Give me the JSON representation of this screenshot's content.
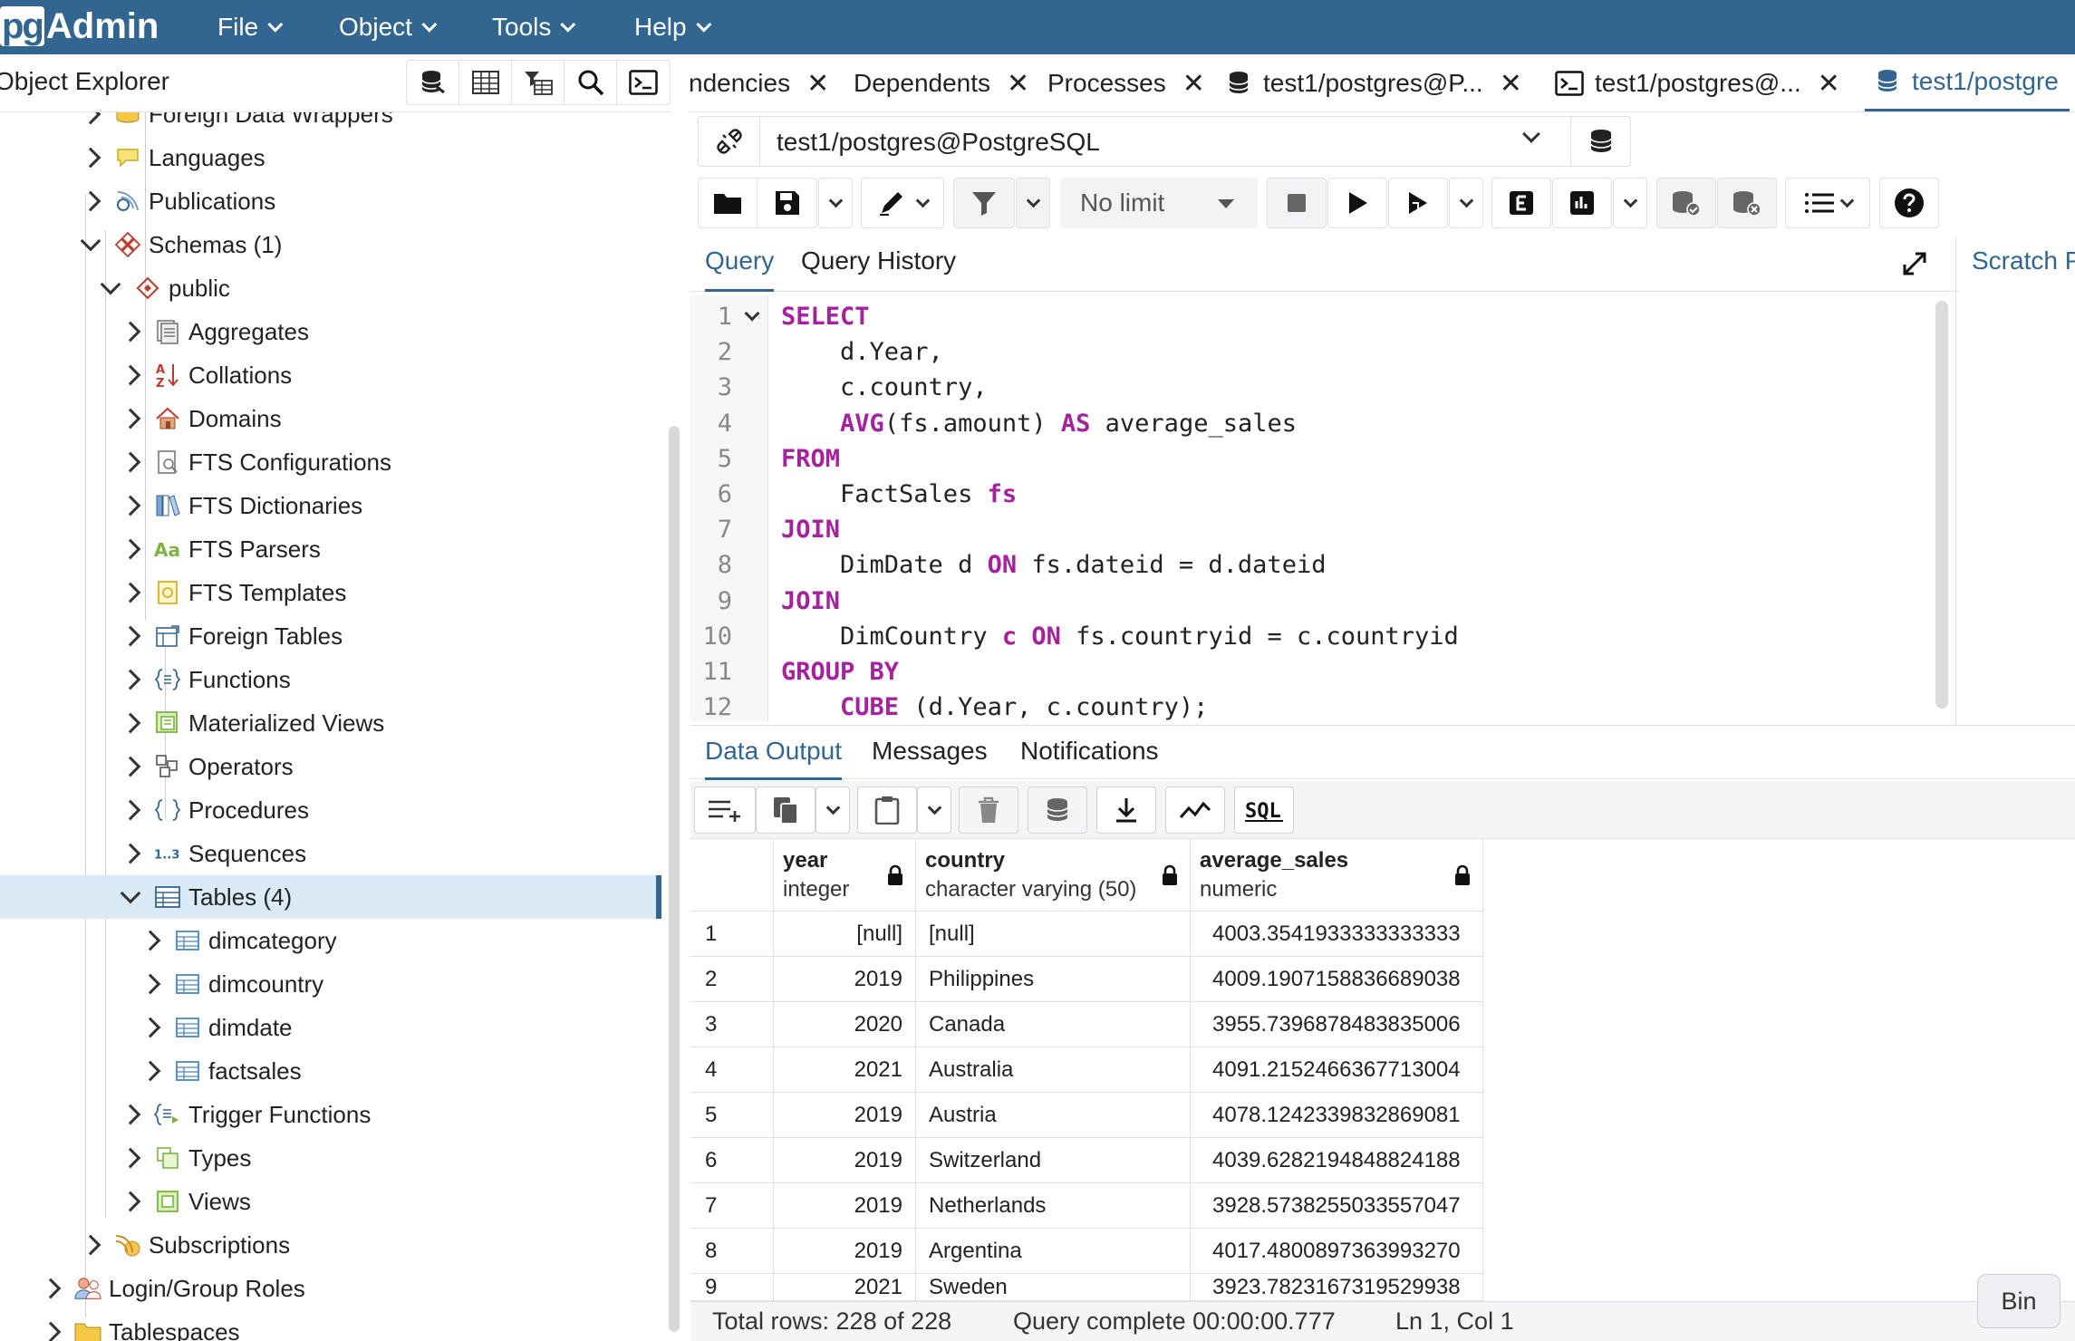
{
  "app": {
    "logo_pg": "pg",
    "logo_admin": "Admin"
  },
  "menu": [
    {
      "label": "File"
    },
    {
      "label": "Object"
    },
    {
      "label": "Tools"
    },
    {
      "label": "Help"
    }
  ],
  "object_explorer": {
    "title": "Object Explorer",
    "tree": [
      {
        "label": "Foreign Data Wrappers",
        "icon": "foreign-data-wrapper-icon",
        "state": "closed"
      },
      {
        "label": "Languages",
        "icon": "language-icon",
        "state": "closed"
      },
      {
        "label": "Publications",
        "icon": "publication-icon",
        "state": "closed"
      },
      {
        "label": "Schemas (1)",
        "icon": "schemas-icon",
        "state": "open"
      },
      {
        "label": "public",
        "icon": "schema-icon",
        "state": "open"
      },
      {
        "label": "Aggregates",
        "icon": "aggregate-icon",
        "state": "closed"
      },
      {
        "label": "Collations",
        "icon": "collation-icon",
        "state": "closed"
      },
      {
        "label": "Domains",
        "icon": "domain-icon",
        "state": "closed"
      },
      {
        "label": "FTS Configurations",
        "icon": "fts-configuration-icon",
        "state": "closed"
      },
      {
        "label": "FTS Dictionaries",
        "icon": "fts-dictionary-icon",
        "state": "closed"
      },
      {
        "label": "FTS Parsers",
        "icon": "fts-parser-icon",
        "state": "closed"
      },
      {
        "label": "FTS Templates",
        "icon": "fts-template-icon",
        "state": "closed"
      },
      {
        "label": "Foreign Tables",
        "icon": "foreign-table-icon",
        "state": "closed"
      },
      {
        "label": "Functions",
        "icon": "function-icon",
        "state": "closed"
      },
      {
        "label": "Materialized Views",
        "icon": "materialized-view-icon",
        "state": "closed"
      },
      {
        "label": "Operators",
        "icon": "operator-icon",
        "state": "closed"
      },
      {
        "label": "Procedures",
        "icon": "procedure-icon",
        "state": "closed"
      },
      {
        "label": "Sequences",
        "icon": "sequence-icon",
        "state": "closed"
      },
      {
        "label": "Tables (4)",
        "icon": "tables-icon",
        "state": "open",
        "selected": true
      },
      {
        "label": "dimcategory",
        "icon": "table-icon",
        "state": "closed"
      },
      {
        "label": "dimcountry",
        "icon": "table-icon",
        "state": "closed"
      },
      {
        "label": "dimdate",
        "icon": "table-icon",
        "state": "closed"
      },
      {
        "label": "factsales",
        "icon": "table-icon",
        "state": "closed"
      },
      {
        "label": "Trigger Functions",
        "icon": "trigger-function-icon",
        "state": "closed"
      },
      {
        "label": "Types",
        "icon": "type-icon",
        "state": "closed"
      },
      {
        "label": "Views",
        "icon": "view-icon",
        "state": "closed"
      },
      {
        "label": "Subscriptions",
        "icon": "subscription-icon",
        "state": "closed"
      },
      {
        "label": "Login/Group Roles",
        "icon": "roles-icon",
        "state": "closed"
      },
      {
        "label": "Tablespaces",
        "icon": "tablespace-icon",
        "state": "closed"
      }
    ]
  },
  "tabs": [
    {
      "label": "ndencies",
      "closable": true
    },
    {
      "label": "Dependents",
      "closable": true
    },
    {
      "label": "Processes",
      "closable": true
    },
    {
      "label": "test1/postgres@P...",
      "icon": "database-icon",
      "closable": true
    },
    {
      "label": "test1/postgres@...",
      "icon": "terminal-icon",
      "closable": true
    },
    {
      "label": "test1/postgre",
      "icon": "database-icon",
      "active": true
    }
  ],
  "connection": {
    "value": "test1/postgres@PostgreSQL"
  },
  "toolbar": {
    "limit_label": "No limit"
  },
  "editor_tabs": [
    {
      "label": "Query",
      "active": true
    },
    {
      "label": "Query History"
    }
  ],
  "scratch_label": "Scratch P",
  "query_lines": [
    {
      "n": "1",
      "parts": [
        {
          "t": "SELECT",
          "k": true
        }
      ]
    },
    {
      "n": "2",
      "parts": [
        {
          "t": "    d.Year,"
        }
      ]
    },
    {
      "n": "3",
      "parts": [
        {
          "t": "    c.country,"
        }
      ]
    },
    {
      "n": "4",
      "parts": [
        {
          "t": "    "
        },
        {
          "t": "AVG",
          "k": true
        },
        {
          "t": "(fs.amount) "
        },
        {
          "t": "AS",
          "k": true
        },
        {
          "t": " average_sales"
        }
      ]
    },
    {
      "n": "5",
      "parts": [
        {
          "t": "FROM",
          "k": true
        }
      ]
    },
    {
      "n": "6",
      "parts": [
        {
          "t": "    FactSales "
        },
        {
          "t": "fs",
          "k": true
        }
      ]
    },
    {
      "n": "7",
      "parts": [
        {
          "t": "JOIN",
          "k": true
        }
      ]
    },
    {
      "n": "8",
      "parts": [
        {
          "t": "    DimDate d "
        },
        {
          "t": "ON",
          "k": true
        },
        {
          "t": " fs.dateid = d.dateid"
        }
      ]
    },
    {
      "n": "9",
      "parts": [
        {
          "t": "JOIN",
          "k": true
        }
      ]
    },
    {
      "n": "10",
      "parts": [
        {
          "t": "    DimCountry "
        },
        {
          "t": "c",
          "k": true
        },
        {
          "t": " "
        },
        {
          "t": "ON",
          "k": true
        },
        {
          "t": " fs.countryid = c.countryid"
        }
      ]
    },
    {
      "n": "11",
      "parts": [
        {
          "t": "GROUP BY",
          "k": true
        }
      ]
    },
    {
      "n": "12",
      "parts": [
        {
          "t": "    "
        },
        {
          "t": "CUBE",
          "k": true
        },
        {
          "t": " (d.Year, c.country);"
        }
      ]
    }
  ],
  "output_tabs": [
    {
      "label": "Data Output",
      "active": true
    },
    {
      "label": "Messages"
    },
    {
      "label": "Notifications"
    }
  ],
  "result": {
    "columns": [
      {
        "name": "year",
        "type": "integer"
      },
      {
        "name": "country",
        "type": "character varying (50)"
      },
      {
        "name": "average_sales",
        "type": "numeric"
      }
    ],
    "rows": [
      {
        "n": "1",
        "year": "[null]",
        "country": "[null]",
        "avg": "4003.3541933333333333"
      },
      {
        "n": "2",
        "year": "2019",
        "country": "Philippines",
        "avg": "4009.1907158836689038"
      },
      {
        "n": "3",
        "year": "2020",
        "country": "Canada",
        "avg": "3955.7396878483835006"
      },
      {
        "n": "4",
        "year": "2021",
        "country": "Australia",
        "avg": "4091.2152466367713004"
      },
      {
        "n": "5",
        "year": "2019",
        "country": "Austria",
        "avg": "4078.1242339832869081"
      },
      {
        "n": "6",
        "year": "2019",
        "country": "Switzerland",
        "avg": "4039.6282194848824188"
      },
      {
        "n": "7",
        "year": "2019",
        "country": "Netherlands",
        "avg": "3928.5738255033557047"
      },
      {
        "n": "8",
        "year": "2019",
        "country": "Argentina",
        "avg": "4017.4800897363993270"
      },
      {
        "n": "9",
        "year": "2021",
        "country": "Sweden",
        "avg": "3923.7823167319529938"
      }
    ]
  },
  "status": {
    "total_rows": "Total rows: 228 of 228",
    "query_complete": "Query complete 00:00:00.777",
    "cursor": "Ln 1, Col 1"
  },
  "bin_label": "Bin"
}
